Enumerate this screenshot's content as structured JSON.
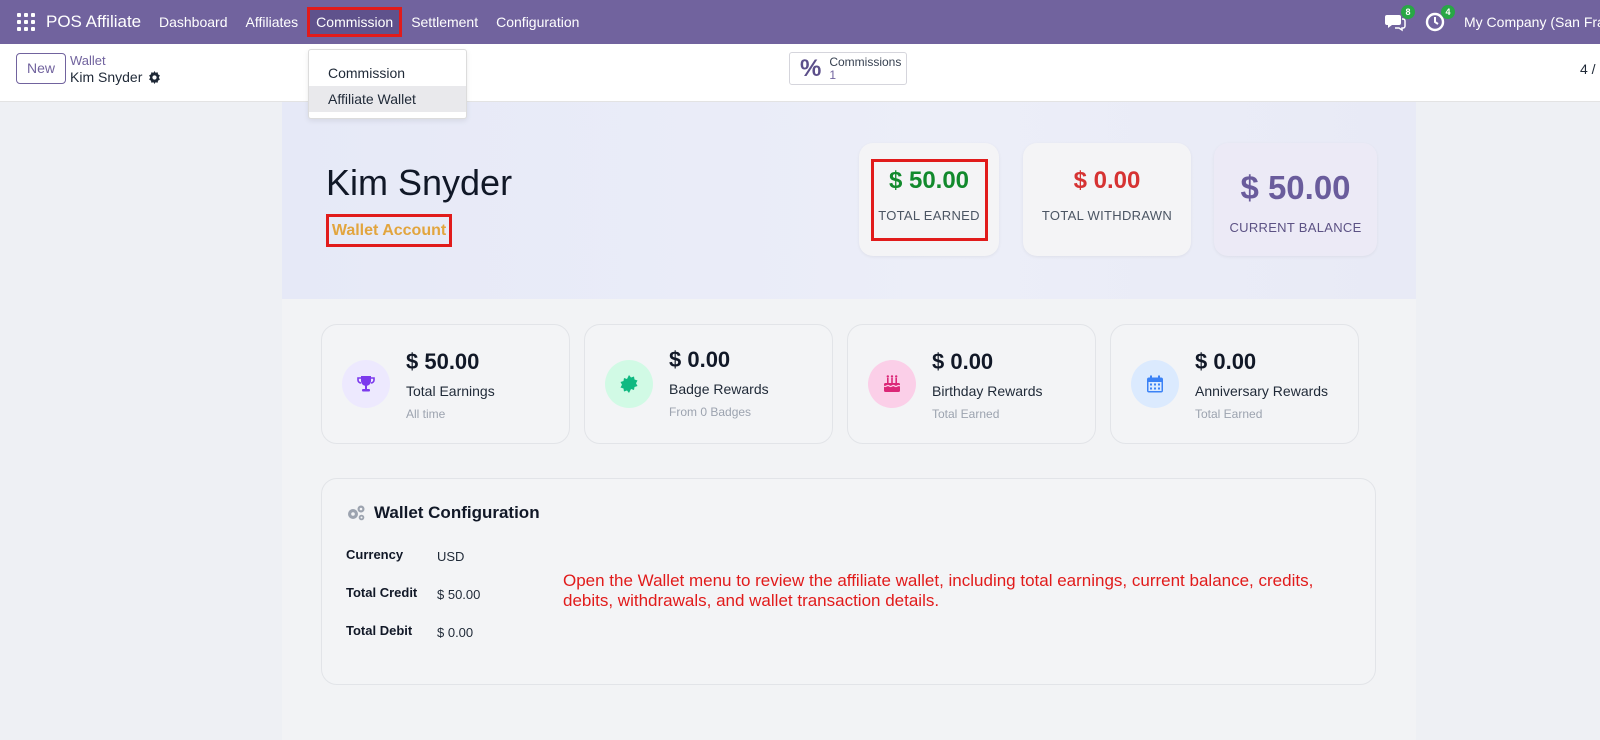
{
  "navbar": {
    "brand": "POS Affiliate",
    "menu": [
      {
        "label": "Dashboard"
      },
      {
        "label": "Affiliates"
      },
      {
        "label": "Commission"
      },
      {
        "label": "Settlement"
      },
      {
        "label": "Configuration"
      }
    ],
    "messages_count": "8",
    "activities_count": "4",
    "company": "My Company (San Francisco)"
  },
  "dropdown": {
    "items": [
      {
        "label": "Commission"
      },
      {
        "label": "Affiliate Wallet"
      }
    ]
  },
  "control": {
    "new_label": "New",
    "breadcrumb_parent": "Wallet",
    "breadcrumb_current": "Kim Snyder",
    "smart_button": {
      "label": "Commissions",
      "value": "1"
    },
    "pager": "4 /"
  },
  "hero": {
    "name": "Kim Snyder",
    "account_label": "Wallet Account",
    "total_earned": {
      "value": "$ 50.00",
      "label": "TOTAL EARNED"
    },
    "total_withdrawn": {
      "value": "$ 0.00",
      "label": "TOTAL WITHDRAWN"
    },
    "current_balance": {
      "value": "$ 50.00",
      "label": "CURRENT BALANCE"
    }
  },
  "cards": [
    {
      "value": "$ 50.00",
      "label": "Total Earnings",
      "sub": "All time",
      "icon": "trophy-icon"
    },
    {
      "value": "$ 0.00",
      "label": "Badge Rewards",
      "sub": "From 0 Badges",
      "icon": "badge-icon"
    },
    {
      "value": "$ 0.00",
      "label": "Birthday Rewards",
      "sub": "Total Earned",
      "icon": "cake-icon"
    },
    {
      "value": "$ 0.00",
      "label": "Anniversary Rewards",
      "sub": "Total Earned",
      "icon": "calendar-icon"
    }
  ],
  "config": {
    "title": "Wallet Configuration",
    "rows": [
      {
        "key": "Currency",
        "value": "USD"
      },
      {
        "key": "Total Credit",
        "value": "$ 50.00"
      },
      {
        "key": "Total Debit",
        "value": "$ 0.00"
      }
    ],
    "note": "Open the Wallet menu to review the affiliate wallet, including total earnings, current balance, credits, debits, withdrawals, and wallet transaction details."
  },
  "colors": {
    "navbar": "#71639e",
    "highlight": "#e11b1b",
    "earned": "#128a2d",
    "withdrawn": "#d63333",
    "balance": "#6a5c9c",
    "account": "#e2a53e"
  }
}
